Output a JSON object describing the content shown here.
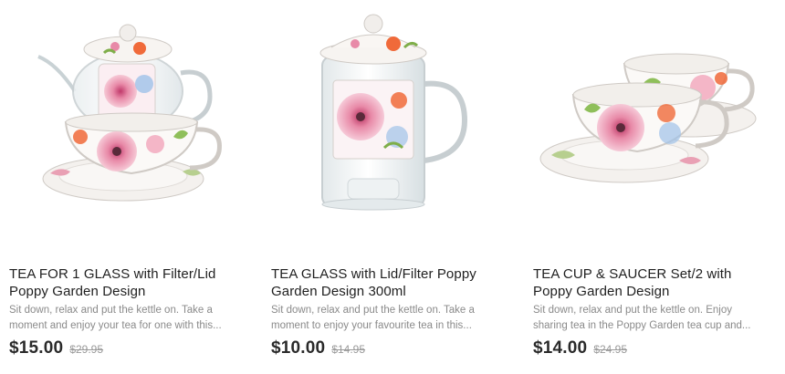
{
  "colors": {
    "title_text": "#1f1f1f",
    "desc_text": "#8a8a8a",
    "price_text": "#2a2a2a",
    "was_price_text": "#9a9a9a",
    "floral_pink": "#e88aa8",
    "floral_orange": "#f06a3a",
    "porcelain": "#f7f5f2"
  },
  "products": [
    {
      "image_icon": "teapot-with-cup-image",
      "title": "TEA FOR 1 GLASS with Filter/Lid Poppy Garden Design",
      "description": "Sit down, relax and put the kettle on. Take a moment and enjoy your tea for one with this...",
      "price": "$15.00",
      "was_price": "$29.95"
    },
    {
      "image_icon": "glass-mug-with-infuser-image",
      "title": "TEA GLASS with Lid/Filter Poppy Garden Design 300ml",
      "description": "Sit down, relax and put the kettle on. Take a moment to enjoy your favourite tea in this...",
      "price": "$10.00",
      "was_price": "$14.95"
    },
    {
      "image_icon": "cup-and-saucer-set-image",
      "title": "TEA CUP & SAUCER Set/2 with Poppy Garden Design",
      "description": "Sit down, relax and put the kettle on. Enjoy sharing tea in the Poppy Garden tea cup and...",
      "price": "$14.00",
      "was_price": "$24.95"
    }
  ]
}
